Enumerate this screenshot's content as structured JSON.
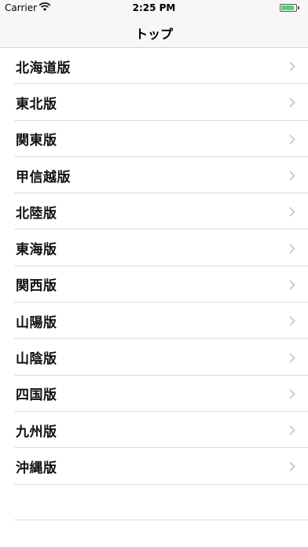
{
  "status_bar": {
    "carrier": "Carrier",
    "time": "2:25 PM",
    "wifi_icon": "wifi-icon",
    "battery_icon": "battery-icon",
    "battery_color": "#4cd964"
  },
  "nav": {
    "title": "トップ"
  },
  "list": {
    "items": [
      {
        "label": "北海道版"
      },
      {
        "label": "東北版"
      },
      {
        "label": "関東版"
      },
      {
        "label": "甲信越版"
      },
      {
        "label": "北陸版"
      },
      {
        "label": "東海版"
      },
      {
        "label": "関西版"
      },
      {
        "label": "山陽版"
      },
      {
        "label": "山陰版"
      },
      {
        "label": "四国版"
      },
      {
        "label": "九州版"
      },
      {
        "label": "沖縄版"
      }
    ],
    "disclosure_icon": "chevron-right-icon"
  }
}
